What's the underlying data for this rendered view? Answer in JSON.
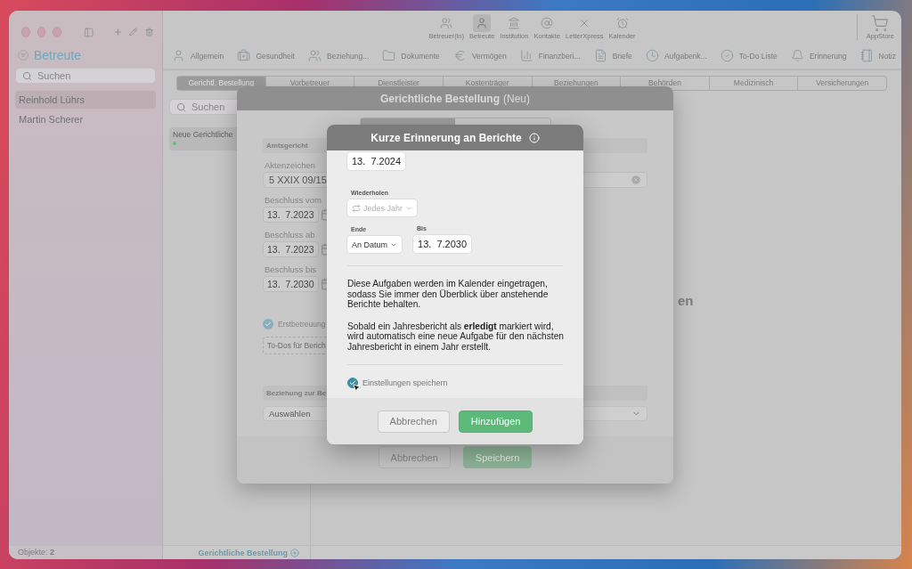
{
  "sidebar": {
    "title": "Betreute",
    "search": {
      "placeholder": "Suchen"
    },
    "items": [
      {
        "label": "Reinhold Lührs",
        "selected": true
      },
      {
        "label": "Martin Scherer",
        "selected": false
      }
    ],
    "footer": {
      "label": "Objekte:",
      "count": "2"
    }
  },
  "toolbar": {
    "modules": [
      {
        "label": "Betreuer(in)",
        "kind": "team",
        "selected": false
      },
      {
        "label": "Betreute",
        "kind": "person",
        "selected": true
      },
      {
        "label": "Institution",
        "kind": "building",
        "selected": false
      },
      {
        "label": "Kontakte",
        "kind": "at",
        "selected": false
      },
      {
        "label": "LetterXpress",
        "kind": "cross",
        "selected": false
      },
      {
        "label": "Kalender",
        "kind": "alarm",
        "selected": false
      }
    ],
    "store": {
      "label": "AppStore"
    }
  },
  "sections": [
    {
      "label": "Allgemein",
      "kind": "person"
    },
    {
      "label": "Gesundheit",
      "kind": "medical"
    },
    {
      "label": "Beziehung...",
      "kind": "pair"
    },
    {
      "label": "Dokumente",
      "kind": "folder"
    },
    {
      "label": "Vermögen",
      "kind": "euro"
    },
    {
      "label": "Finanzberi...",
      "kind": "chart"
    },
    {
      "label": "Briefe",
      "kind": "file"
    },
    {
      "label": "Aufgabenk...",
      "kind": "clock"
    },
    {
      "label": "To-Do Liste",
      "kind": "check"
    },
    {
      "label": "Erinnerung",
      "kind": "bell"
    },
    {
      "label": "Notiz",
      "kind": "note"
    }
  ],
  "tabs": [
    {
      "label": "Gerichtl. Bestellung",
      "selected": true
    },
    {
      "label": "Vorbetreuer",
      "selected": false
    },
    {
      "label": "Dienstleister",
      "selected": false
    },
    {
      "label": "Kostenträger",
      "selected": false
    },
    {
      "label": "Beziehungen",
      "selected": false
    },
    {
      "label": "Behörden",
      "selected": false
    },
    {
      "label": "Medizinisch",
      "selected": false
    },
    {
      "label": "Versicherungen",
      "selected": false
    }
  ],
  "list": {
    "search": {
      "placeholder": "Suchen"
    },
    "items": [
      {
        "label": "Neue Gerichtliche",
        "selected": true,
        "color": "#5cc46a"
      }
    ],
    "footer": "Gerichtliche Bestellung"
  },
  "detail_text": "en",
  "order_dialog": {
    "title": "Gerichtliche Bestellung",
    "title_suffix": "(Neu)",
    "court_header": "Amtsgericht",
    "file_label": "Aktenzeichen",
    "file_value": "5 XXIX 09/15",
    "dates": [
      {
        "label": "Beschluss vom",
        "value": "13.  7.2023"
      },
      {
        "label": "Beschluss ab",
        "value": "13.  7.2023"
      },
      {
        "label": "Beschluss bis",
        "value": "13.  7.2030"
      }
    ],
    "first_care": {
      "label": "Erstbetreuung",
      "checked": true
    },
    "todo_button": "To-Dos für Berich",
    "relation_header": "Beziehung zur Be",
    "relation_select": "Auswählen",
    "buttons": [
      {
        "label": "Abbrechen",
        "kind": "secondary"
      },
      {
        "label": "Speichern",
        "kind": "primary"
      }
    ]
  },
  "reminder_dialog": {
    "title": "Kurze Erinnerung an Berichte",
    "start_date": "13.  7.2024",
    "repeat": {
      "label": "Wiederholen",
      "value": "Jedes Jahr",
      "disabled": true
    },
    "end": {
      "label": "Ende",
      "value": "An Datum"
    },
    "until": {
      "label": "Bis",
      "value": "13.  7.2030"
    },
    "paragraphs": [
      "Diese Aufgaben werden im Kalender eingetragen, sodass Sie immer den Überblick über anstehende Berichte behalten.",
      "Sobald ein Jahresbericht als **erledigt** markiert wird, wird automatisch eine neue Aufgabe für den nächsten Jahresbericht in einem Jahr erstellt."
    ],
    "save_settings": {
      "label": "Einstellungen speichern",
      "checked": true
    },
    "buttons": [
      {
        "label": "Abbrechen",
        "kind": "secondary"
      },
      {
        "label": "Hinzufügen",
        "kind": "primary"
      }
    ]
  }
}
